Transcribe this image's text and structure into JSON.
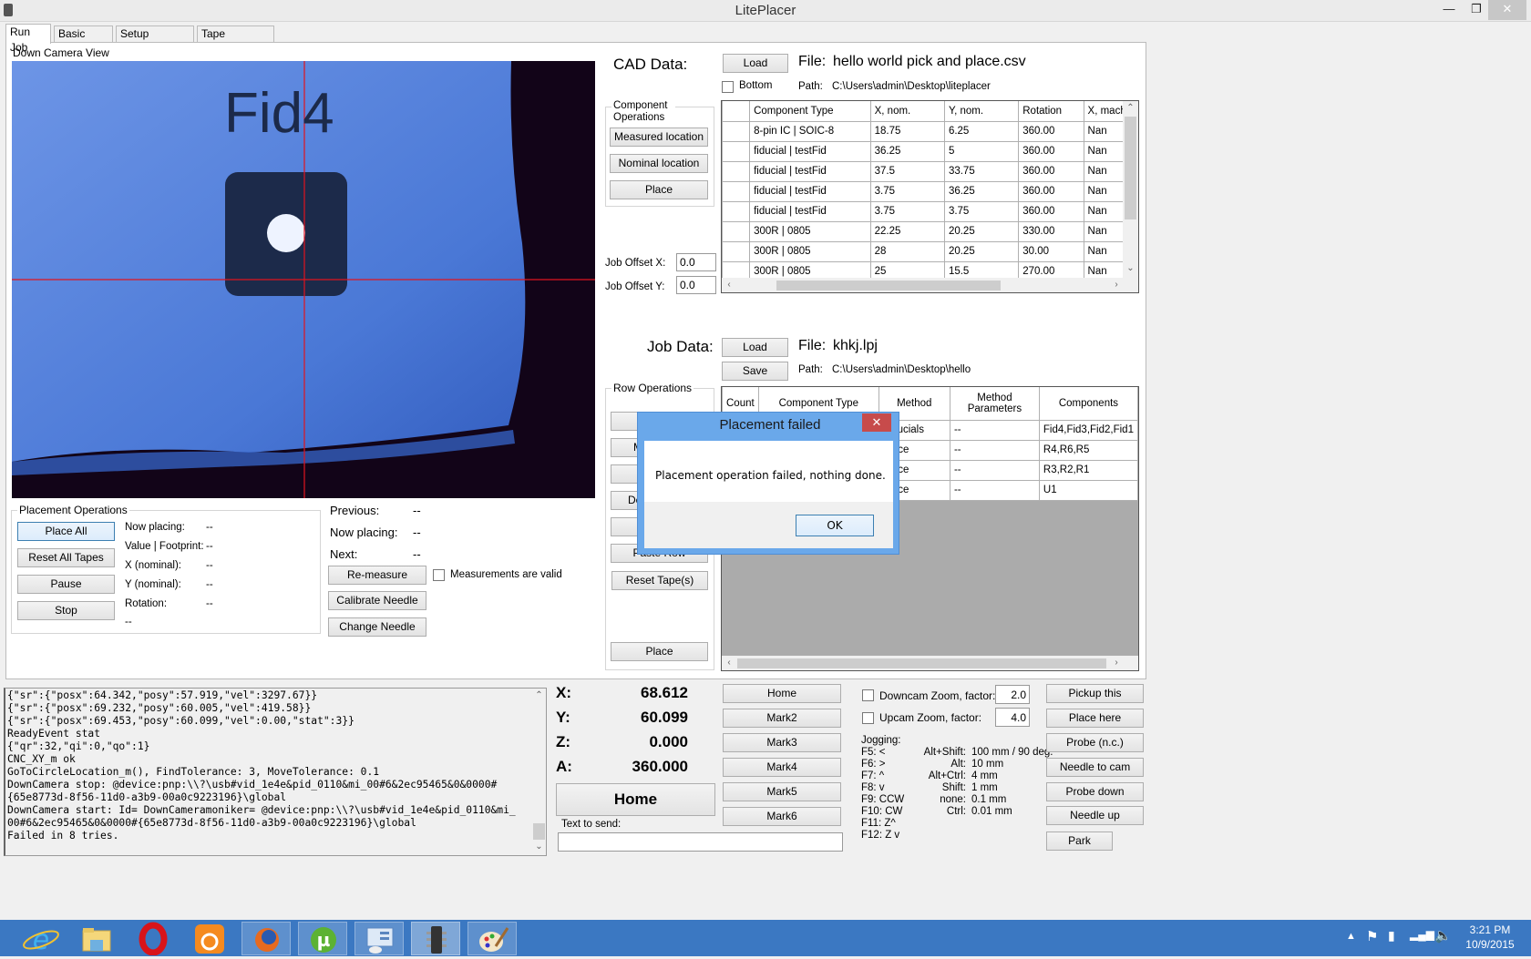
{
  "window": {
    "title": "LitePlacer",
    "minimize": "—",
    "restore": "❐",
    "close": "✕"
  },
  "tabs": [
    {
      "label": "Run Job",
      "active": true
    },
    {
      "label": "Basic Setup",
      "active": false
    },
    {
      "label": "Setup Cameras",
      "active": false
    },
    {
      "label": "Tape Positions",
      "active": false
    }
  ],
  "camera": {
    "label": "Down Camera View",
    "overlay_text": "Fid4"
  },
  "cad": {
    "label": "CAD Data:",
    "load_label": "Load",
    "file_label": "File:",
    "file_name": "hello world pick and place.csv",
    "bottom_label": "Bottom",
    "bottom_checked": false,
    "path_label": "Path:",
    "path": "C:\\Users\\admin\\Desktop\\liteplacer",
    "columns": [
      "",
      "Component Type",
      "X, nom.",
      "Y, nom.",
      "Rotation",
      "X, machin"
    ],
    "rows": [
      [
        "",
        "8-pin IC  |  SOIC-8",
        "18.75",
        "6.25",
        "360.00",
        "Nan"
      ],
      [
        "",
        "fiducial  |  testFid",
        "36.25",
        "5",
        "360.00",
        "Nan"
      ],
      [
        "",
        "fiducial  |  testFid",
        "37.5",
        "33.75",
        "360.00",
        "Nan"
      ],
      [
        "",
        "fiducial  |  testFid",
        "3.75",
        "36.25",
        "360.00",
        "Nan"
      ],
      [
        "",
        "fiducial  |  testFid",
        "3.75",
        "3.75",
        "360.00",
        "Nan"
      ],
      [
        "",
        "300R  |  0805",
        "22.25",
        "20.25",
        "330.00",
        "Nan"
      ],
      [
        "",
        "300R  |  0805",
        "28",
        "20.25",
        "30.00",
        "Nan"
      ],
      [
        "",
        "300R  |  0805",
        "25",
        "15.5",
        "270.00",
        "Nan"
      ]
    ]
  },
  "component_ops": {
    "title": "Component Operations",
    "measured": "Measured location",
    "nominal": "Nominal location",
    "place": "Place"
  },
  "job_offset": {
    "x_label": "Job Offset X:",
    "x_value": "0.0",
    "y_label": "Job Offset Y:",
    "y_value": "0.0"
  },
  "job": {
    "label": "Job Data:",
    "load_label": "Load",
    "save_label": "Save",
    "file_label": "File:",
    "file_name": "khkj.lpj",
    "path_label": "Path:",
    "path": "C:\\Users\\admin\\Desktop\\hello",
    "columns": [
      "Count",
      "Component Type",
      "Method",
      "Method Parameters",
      "Components"
    ],
    "rows": [
      [
        "",
        "",
        "Fiducials",
        "--",
        "Fid4,Fid3,Fid2,Fid1"
      ],
      [
        "",
        "",
        "Place",
        "--",
        "R4,R6,R5"
      ],
      [
        "",
        "",
        "Place",
        "--",
        "R3,R2,R1"
      ],
      [
        "",
        "",
        "Place",
        "--",
        "U1"
      ]
    ],
    "visible_method_fragments": [
      "cials",
      "e",
      "e",
      "e"
    ]
  },
  "row_ops": {
    "title": "Row Operations",
    "buttons": [
      "",
      "M",
      "",
      "De",
      "",
      "Paste Row"
    ],
    "reset_tapes": "Reset Tape(s)",
    "place": "Place"
  },
  "placement_ops": {
    "title": "Placement Operations",
    "place_all": "Place All",
    "reset_all_tapes": "Reset All Tapes",
    "pause": "Pause",
    "stop": "Stop",
    "fields": [
      {
        "label": "Now placing:",
        "value": "--"
      },
      {
        "label": "Value | Footprint:",
        "value": "--"
      },
      {
        "label": "X (nominal):",
        "value": "--"
      },
      {
        "label": "Y (nominal):",
        "value": "--"
      },
      {
        "label": "Rotation:",
        "value": "--"
      }
    ],
    "extra_value": "--"
  },
  "status": {
    "previous_label": "Previous:",
    "previous_value": "--",
    "now_label": "Now placing:",
    "now_value": "--",
    "next_label": "Next:",
    "next_value": "--",
    "remeasure": "Re-measure",
    "valid_label": "Measurements are valid",
    "valid_checked": false,
    "calibrate": "Calibrate Needle",
    "change": "Change Needle"
  },
  "log": {
    "lines": [
      "{\"sr\":{\"posx\":64.342,\"posy\":57.919,\"vel\":3297.67}}",
      "{\"sr\":{\"posx\":69.232,\"posy\":60.005,\"vel\":419.58}}",
      "{\"sr\":{\"posx\":69.453,\"posy\":60.099,\"vel\":0.00,\"stat\":3}}",
      "ReadyEvent stat",
      "{\"qr\":32,\"qi\":0,\"qo\":1}",
      "CNC_XY_m ok",
      "GoToCircleLocation_m(), FindTolerance: 3, MoveTolerance: 0.1",
      "DownCamera stop: @device:pnp:\\\\?\\usb#vid_1e4e&pid_0110&mi_00#6&2ec95465&0&0000#",
      "{65e8773d-8f56-11d0-a3b9-00a0c9223196}\\global",
      "DownCamera start: Id= DownCameramoniker= @device:pnp:\\\\?\\usb#vid_1e4e&pid_0110&mi_",
      "00#6&2ec95465&0&0000#{65e8773d-8f56-11d0-a3b9-00a0c9223196}\\global",
      "Failed in 8 tries."
    ]
  },
  "coords": [
    {
      "label": "X:",
      "value": "68.612"
    },
    {
      "label": "Y:",
      "value": "60.099"
    },
    {
      "label": "Z:",
      "value": "0.000"
    },
    {
      "label": "A:",
      "value": "360.000"
    }
  ],
  "home_big": "Home",
  "send": {
    "label": "Text to send:",
    "value": ""
  },
  "marks": [
    "Home",
    "Mark2",
    "Mark3",
    "Mark4",
    "Mark5",
    "Mark6"
  ],
  "zoom": {
    "down_label": "Downcam Zoom, factor:",
    "down_value": "2.0",
    "down_checked": false,
    "up_label": "Upcam Zoom, factor:",
    "up_value": "4.0",
    "up_checked": false
  },
  "jogging": {
    "title": "Jogging:",
    "keys": [
      "F5: <",
      "F6: >",
      "F7: ^",
      "F8: v",
      "F9: CCW",
      "F10: CW",
      "F11: Z^",
      "F12: Z v"
    ],
    "modifiers": [
      {
        "key": "Alt+Shift:",
        "value": "100 mm / 90 deg."
      },
      {
        "key": "Alt:",
        "value": "10 mm"
      },
      {
        "key": "Alt+Ctrl:",
        "value": "4 mm"
      },
      {
        "key": "Shift:",
        "value": "1 mm"
      },
      {
        "key": "none:",
        "value": "0.1 mm"
      },
      {
        "key": "Ctrl:",
        "value": "0.01 mm"
      }
    ]
  },
  "actions": [
    "Pickup this",
    "Place here",
    "Probe (n.c.)",
    "Needle to cam",
    "Probe down",
    "Needle up",
    "Park"
  ],
  "dialog": {
    "title": "Placement failed",
    "message": "Placement operation failed, nothing done.",
    "ok": "OK",
    "close": "✕"
  },
  "taskbar": {
    "apps": [
      "internet-explorer",
      "file-explorer",
      "opera",
      "uc-browser",
      "firefox",
      "utorrent",
      "control-panel",
      "liteplacer",
      "paint"
    ],
    "time": "3:21 PM",
    "date": "10/9/2015"
  },
  "colors": {
    "accent": "#3b78c2",
    "dialog_frame": "#6aa8ea",
    "dialog_close": "#c74b4b",
    "crosshair": "#e0141e",
    "camera_blue": "#4f7fd8"
  }
}
